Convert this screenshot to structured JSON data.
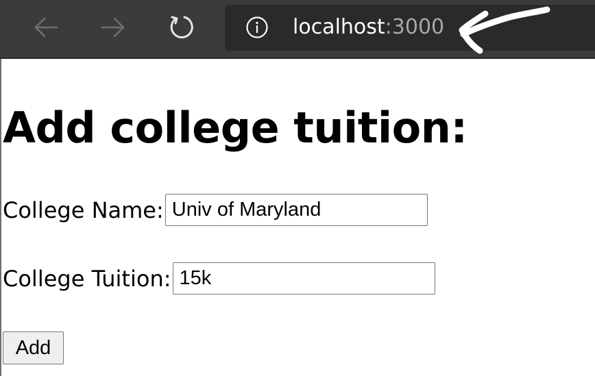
{
  "browser": {
    "url_host": "localhost",
    "url_separator": ":",
    "url_port": "3000",
    "icons": {
      "back": "arrow-left-icon",
      "forward": "arrow-right-icon",
      "reload": "reload-icon",
      "site_info": "info-icon"
    },
    "colors": {
      "toolbar_bg": "#3b3b3b",
      "address_bar_bg": "#2a2a2a",
      "icon_color": "#6f6f6f",
      "reload_icon_color": "#e8e8e8",
      "port_color": "#a8a8a8"
    }
  },
  "annotation": {
    "type": "hand-drawn-arrow",
    "color": "#ffffff"
  },
  "page": {
    "title": "Add college tuition:",
    "form": {
      "college_name_label": "College Name:",
      "college_name_value": "Univ of Maryland",
      "college_tuition_label": "College Tuition:",
      "college_tuition_value": "15k",
      "submit_label": "Add"
    }
  }
}
